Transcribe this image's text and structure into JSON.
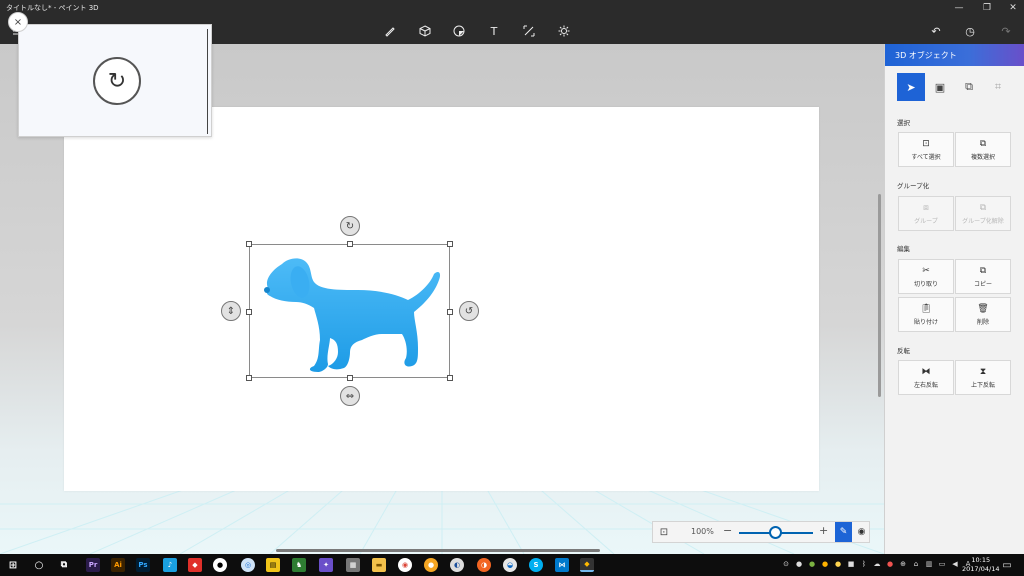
{
  "window": {
    "title": "タイトルなし* - ペイント 3D",
    "minimize_icon": "minimize-icon",
    "maximize_icon": "restore-icon",
    "close_icon": "close-icon"
  },
  "toolbar": {
    "menu_icon": "hamburger-menu-icon",
    "tools": [
      "brush-icon",
      "cube-icon",
      "sticker-icon",
      "text-icon",
      "canvas-icon",
      "effects-icon"
    ],
    "text_tool_glyph": "T",
    "undo_icon": "undo-icon",
    "history_icon": "history-icon",
    "redo_icon": "redo-icon"
  },
  "preview": {
    "close_glyph": "×",
    "knob_glyph": "↻"
  },
  "selection": {
    "object": "dog-3d-model",
    "object_color": "#29a8f0"
  },
  "zoom": {
    "value": "100%",
    "minus": "−",
    "plus": "+",
    "level_percent": 100
  },
  "panel": {
    "title": "3D オブジェクト",
    "accent": "#1e63d6",
    "tabs": [
      "select-icon",
      "scene-icon",
      "clipboard-icon",
      "crop-icon"
    ],
    "sections": {
      "select": {
        "title": "選択",
        "buttons": [
          "すべて選択",
          "複数選択"
        ]
      },
      "group": {
        "title": "グループ化",
        "buttons": [
          "グループ",
          "グループ化解除"
        ]
      },
      "edit": {
        "title": "編集",
        "buttons": [
          "切り取り",
          "コピー",
          "貼り付け",
          "削除"
        ]
      },
      "flip": {
        "title": "反転",
        "buttons": [
          "左右反転",
          "上下反転"
        ]
      }
    }
  },
  "taskbar": {
    "time": "10:15",
    "date": "2017/04/14",
    "apps": [
      "start",
      "cortana",
      "task-view",
      "premiere",
      "illustrator",
      "photoshop",
      "tiktok-like",
      "red-app",
      "soccer",
      "blue-circle",
      "yellow-app",
      "green-app",
      "app",
      "app",
      "folder",
      "chrome",
      "orange-app",
      "orange-app",
      "blue-app",
      "skype",
      "visual-studio",
      "paint-3d"
    ]
  }
}
